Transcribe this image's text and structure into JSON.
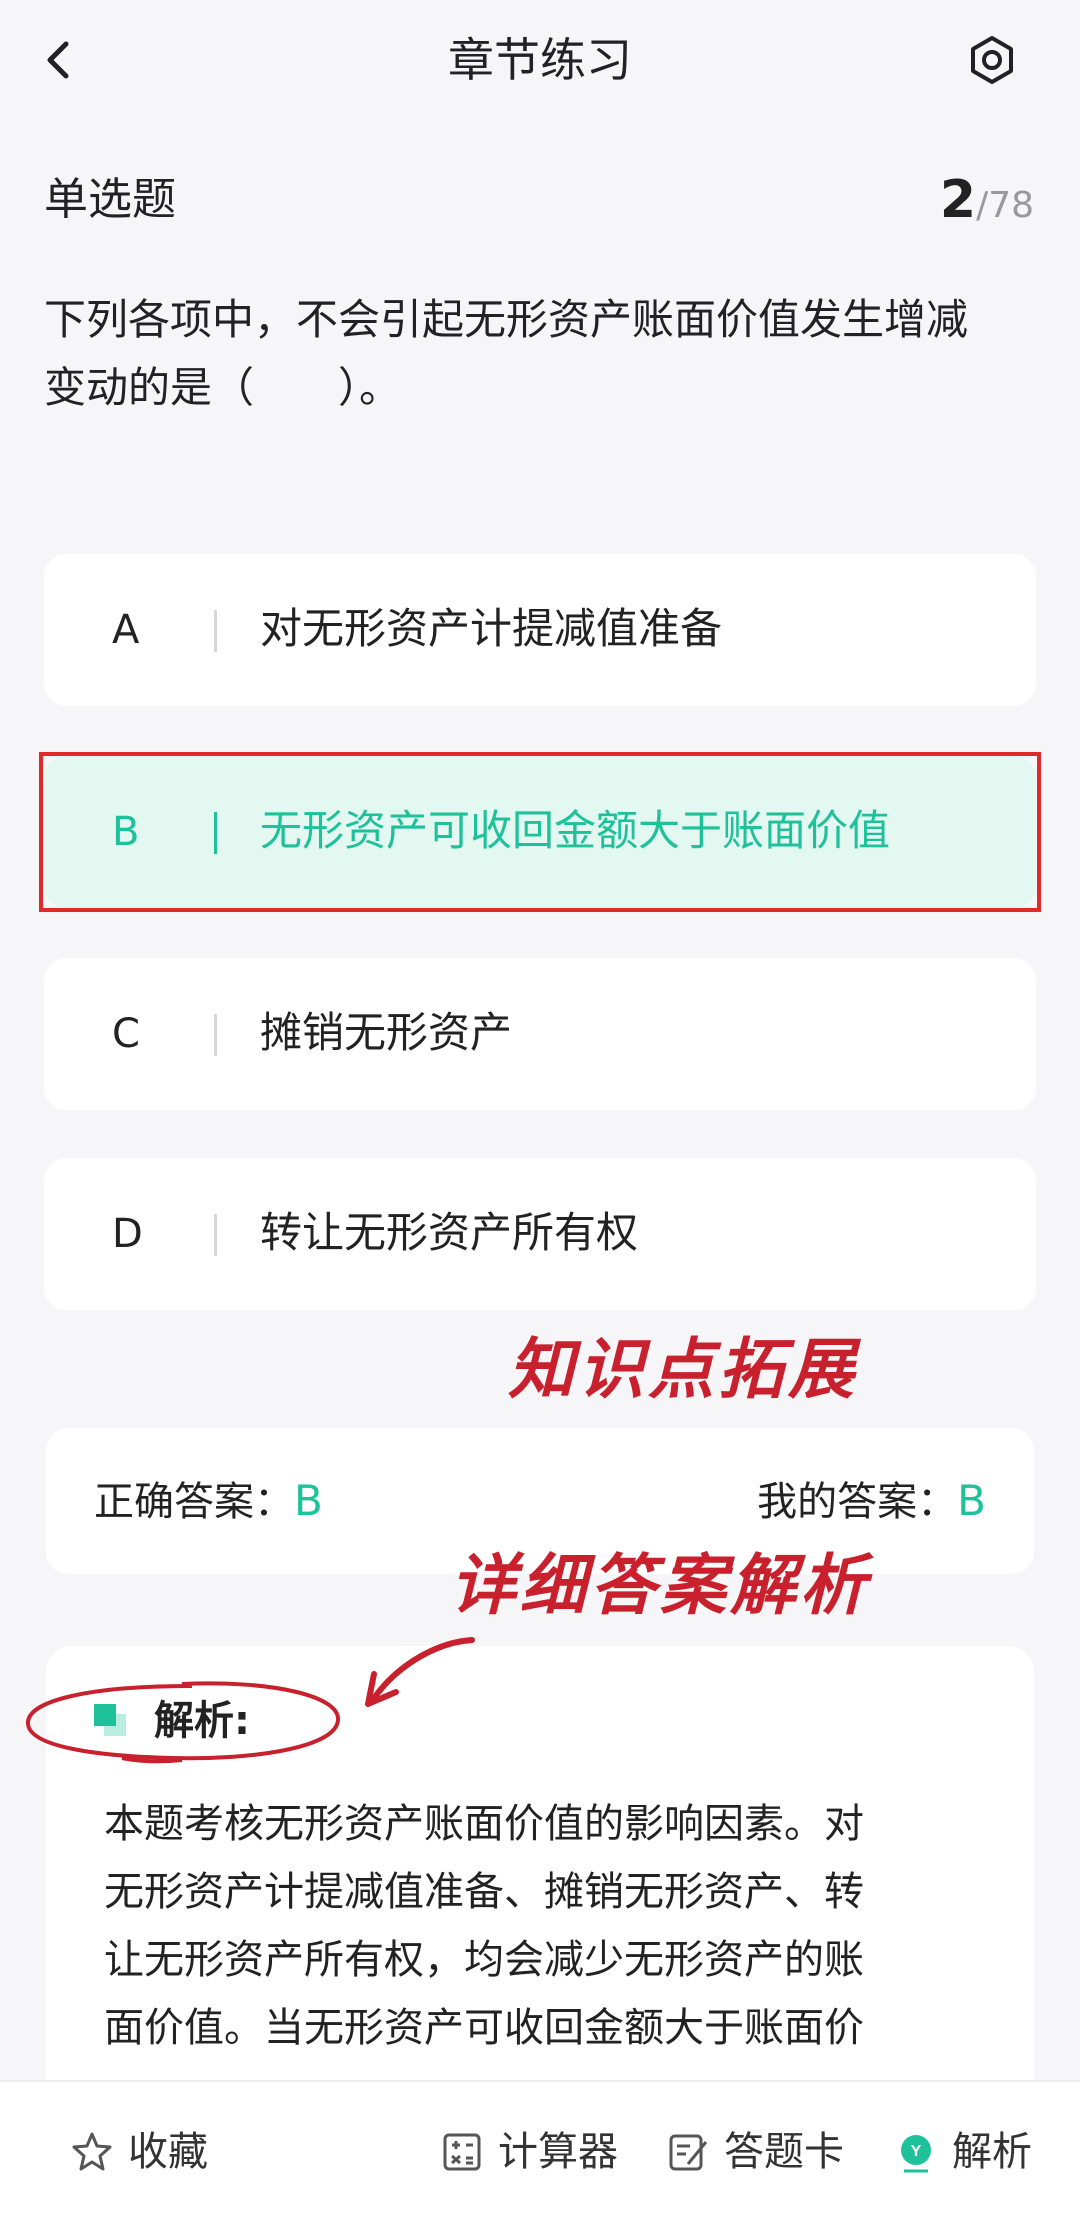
{
  "nav": {
    "title": "章节练习"
  },
  "question": {
    "type": "单选题",
    "current": "2",
    "total": "/78",
    "stem_line1": "下列各项中，不会引起无形资产账面价值发生增减",
    "stem_line2": "变动的是（　　）。"
  },
  "options": [
    {
      "letter": "A",
      "text": "对无形资产计提减值准备",
      "selected": false
    },
    {
      "letter": "B",
      "text": "无形资产可收回金额大于账面价值",
      "selected": true
    },
    {
      "letter": "C",
      "text": "摊销无形资产",
      "selected": false
    },
    {
      "letter": "D",
      "text": "转让无形资产所有权",
      "selected": false
    }
  ],
  "annotations": {
    "knowledge": "知识点拓展",
    "detail": "详细答案解析"
  },
  "answers": {
    "correct_label": "正确答案：",
    "correct_value": "B",
    "mine_label": "我的答案：",
    "mine_value": "B"
  },
  "analysis": {
    "title": "解析:",
    "lines": [
      "本题考核无形资产账面价值的影响因素。对",
      "无形资产计提减值准备、摊销无形资产、转",
      "让无形资产所有权，均会减少无形资产的账",
      "面价值。当无形资产可收回金额大于账面价"
    ]
  },
  "bottom_bar": {
    "favorite": "收藏",
    "calculator": "计算器",
    "answer_sheet": "答题卡",
    "analysis": "解析"
  },
  "colors": {
    "accent": "#1ec199",
    "annotation_red": "#c8202c",
    "selected_bg": "#e3f8f1"
  }
}
